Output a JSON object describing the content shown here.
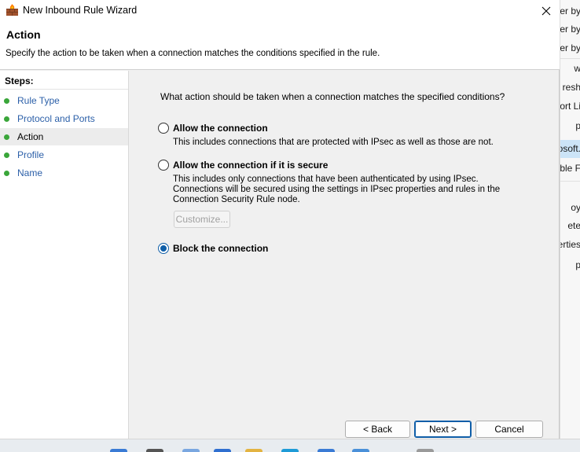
{
  "window": {
    "title": "New Inbound Rule Wizard"
  },
  "header": {
    "title": "Action",
    "description": "Specify the action to be taken when a connection matches the conditions specified in the rule."
  },
  "steps": {
    "label": "Steps:",
    "items": [
      {
        "label": "Rule Type"
      },
      {
        "label": "Protocol and Ports"
      },
      {
        "label": "Action"
      },
      {
        "label": "Profile"
      },
      {
        "label": "Name"
      }
    ]
  },
  "content": {
    "question": "What action should be taken when a connection matches the specified conditions?",
    "options": [
      {
        "label": "Allow the connection",
        "description": "This includes connections that are protected with IPsec as well as those are not.",
        "selected": false
      },
      {
        "label": "Allow the connection if it is secure",
        "description": "This includes only connections that have been authenticated by using IPsec.  Connections will be secured using the settings in IPsec properties and rules in the Connection Security Rule node.",
        "selected": false
      },
      {
        "label": "Block the connection",
        "selected": true
      }
    ],
    "customize_label": "Customize..."
  },
  "buttons": {
    "back": "< Back",
    "next": "Next >",
    "cancel": "Cancel"
  },
  "background_window": {
    "items": [
      "er by",
      "er by",
      "er by",
      "w",
      "resh",
      "ort Li",
      "p",
      "osoft.",
      "able F",
      "oy",
      "ete",
      "perties",
      "p"
    ]
  },
  "colors": {
    "accent": "#0f5ea8",
    "link": "#2b5fa8",
    "step_dot": "#3aa63a"
  }
}
